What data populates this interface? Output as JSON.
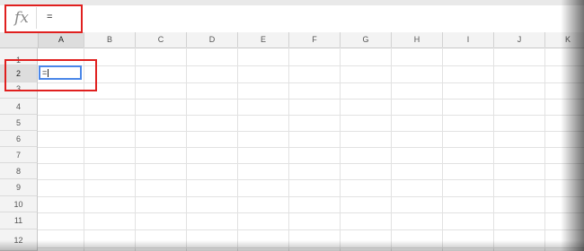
{
  "formula_bar": {
    "fx_label": "fx",
    "content": "="
  },
  "columns": [
    "A",
    "B",
    "C",
    "D",
    "E",
    "F",
    "G",
    "H",
    "I",
    "J",
    "K"
  ],
  "rows": [
    "1",
    "2",
    "3",
    "4",
    "5",
    "6",
    "7",
    "8",
    "9",
    "10",
    "11",
    "12"
  ],
  "active_cell": {
    "ref": "A2",
    "value": "="
  },
  "colors": {
    "highlight": "#e0201f",
    "selection": "#4a86e8"
  }
}
